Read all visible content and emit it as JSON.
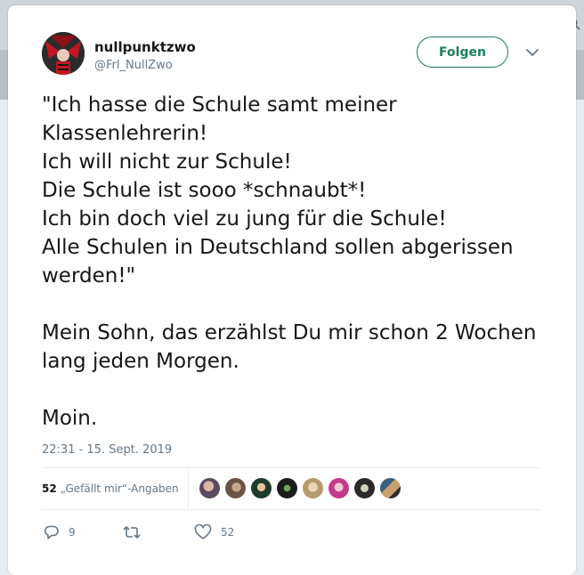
{
  "tweet": {
    "display_name": "nullpunktzwo",
    "handle": "@Frl_NullZwo",
    "follow_label": "Folgen",
    "text": "\"Ich hasse die Schule samt meiner Klassenlehrerin!\nIch will nicht zur Schule!\nDie Schule ist sooo *schnaubt*!\nIch bin doch viel zu jung für die Schule!\nAlle Schulen in Deutschland sollen abgerissen werden!\"\n\nMein Sohn, das erzählst Du mir schon 2 Wochen lang jeden Morgen.\n\nMoin.",
    "timestamp": "22:31 - 15. Sept. 2019"
  },
  "likes": {
    "count": "52",
    "label": "„Gefällt mir“-Angaben"
  },
  "actions": {
    "reply_count": "9",
    "retweet_count": "",
    "like_count": "52"
  },
  "colors": {
    "accent": "#1b7f5a",
    "text": "#14171a",
    "muted": "#657786"
  },
  "icons": {
    "reply": "reply-icon",
    "retweet": "retweet-icon",
    "like": "heart-icon",
    "more": "chevron-down-icon"
  }
}
